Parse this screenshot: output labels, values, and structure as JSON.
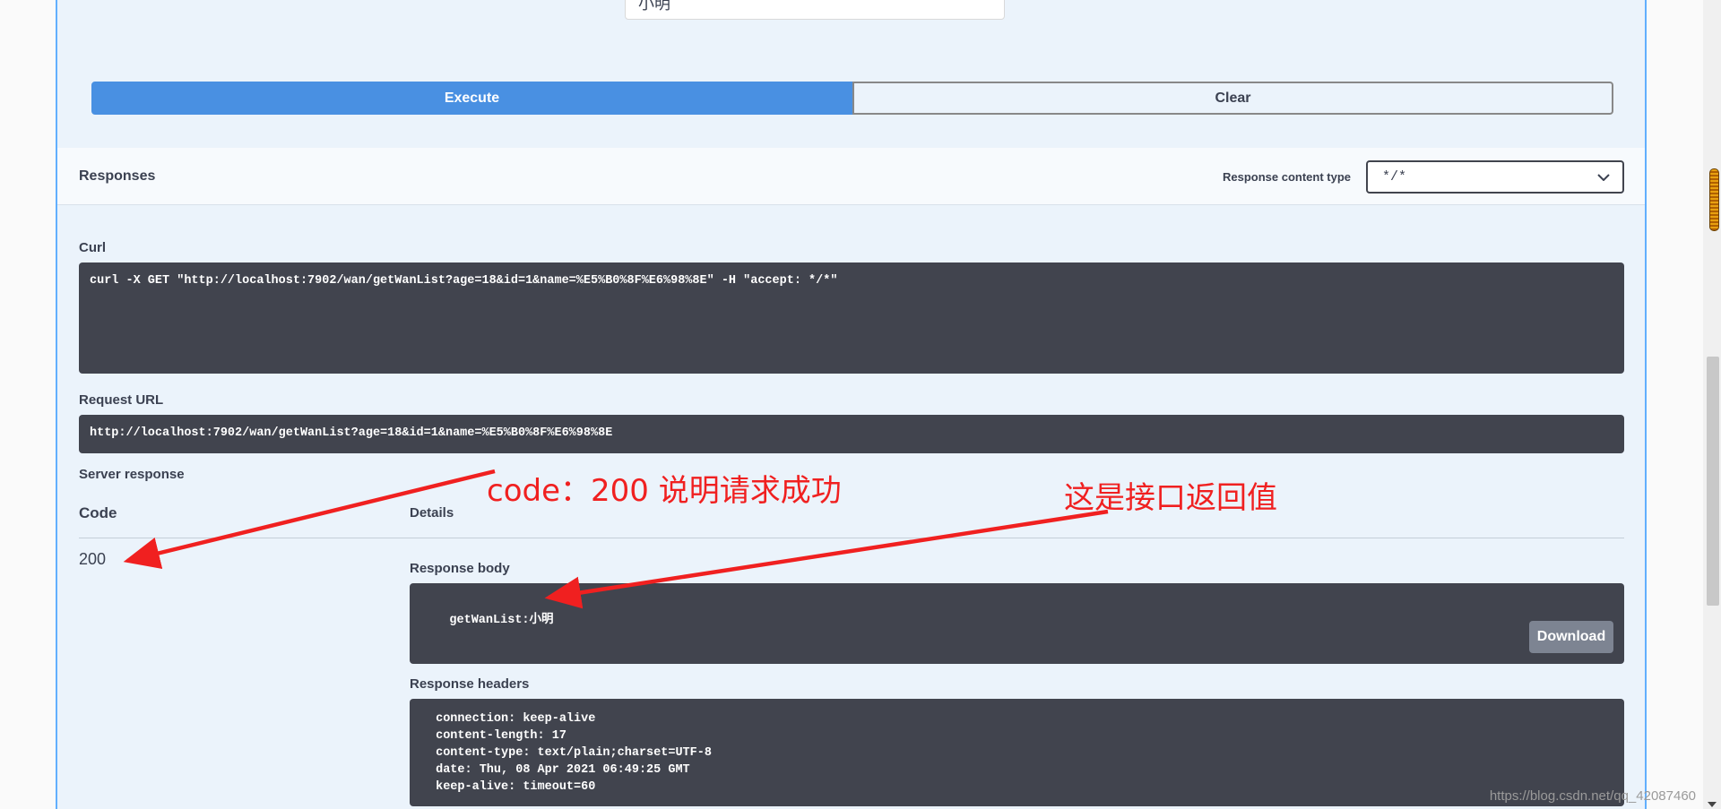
{
  "parameter": {
    "name_value": "小明"
  },
  "actions": {
    "execute_label": "Execute",
    "clear_label": "Clear"
  },
  "responses": {
    "title": "Responses",
    "content_type_label": "Response content type",
    "content_type_value": "*/*"
  },
  "curl": {
    "label": "Curl",
    "command": "curl -X GET \"http://localhost:7902/wan/getWanList?age=18&id=1&name=%E5%B0%8F%E6%98%8E\" -H \"accept: */*\""
  },
  "request_url": {
    "label": "Request URL",
    "value": "http://localhost:7902/wan/getWanList?age=18&id=1&name=%E5%B0%8F%E6%98%8E"
  },
  "server_response": {
    "label": "Server response",
    "code_header": "Code",
    "details_header": "Details",
    "code": "200",
    "body_label": "Response body",
    "body": "getWanList:小明",
    "download_label": "Download",
    "headers_label": "Response headers",
    "headers": " connection: keep-alive\n content-length: 17\n content-type: text/plain;charset=UTF-8\n date: Thu, 08 Apr 2021 06:49:25 GMT\n keep-alive: timeout=60"
  },
  "annotations": {
    "code_note": "code：200 说明请求成功",
    "body_note": "这是接口返回值",
    "color": "#f02020"
  },
  "watermark": "https://blog.csdn.net/qq_42087460",
  "colors": {
    "accent": "#4990e2",
    "panel_bg": "#ebf3fb",
    "code_bg": "#41444e",
    "border": "#61affe"
  }
}
